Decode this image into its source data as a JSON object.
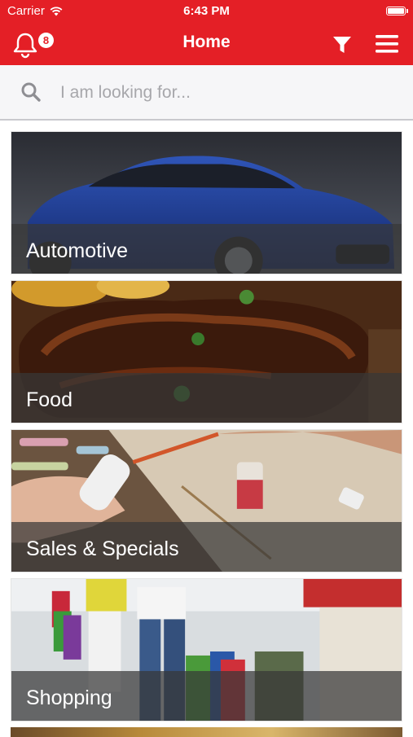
{
  "status_bar": {
    "carrier": "Carrier",
    "time": "6:43 PM"
  },
  "nav": {
    "title": "Home",
    "notification_count": "8"
  },
  "search": {
    "placeholder": "I am looking for..."
  },
  "categories": [
    {
      "label": "Automotive"
    },
    {
      "label": "Food"
    },
    {
      "label": "Sales & Specials"
    },
    {
      "label": "Shopping"
    }
  ],
  "colors": {
    "brand_red": "#e41f26",
    "search_bg": "#f6f6f8"
  },
  "icons": [
    "wifi-icon",
    "battery-icon",
    "bell-icon",
    "filter-icon",
    "menu-icon",
    "search-icon"
  ]
}
